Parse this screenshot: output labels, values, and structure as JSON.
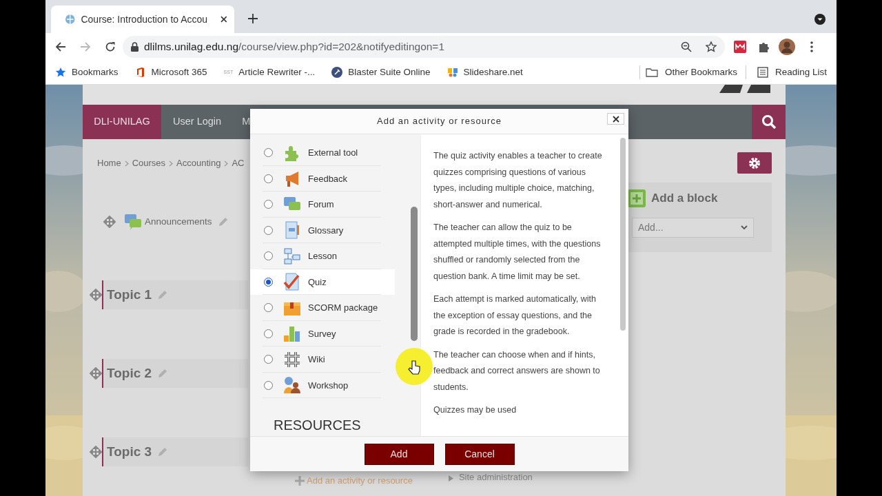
{
  "browser": {
    "tab": {
      "title": "Course: Introduction to Accou"
    },
    "url": {
      "host": "dlilms.unilag.edu.ng",
      "path": "/course/view.php?id=202&notifyeditingon=1"
    },
    "bookmarks": [
      {
        "label": "Bookmarks"
      },
      {
        "label": "Microsoft 365"
      },
      {
        "label": "Article Rewriter -...",
        "icon_text": "SST"
      },
      {
        "label": "Blaster Suite Online"
      },
      {
        "label": "Slideshare.net"
      }
    ],
    "other_bookmarks": "Other Bookmarks",
    "reading_list": "Reading List"
  },
  "site": {
    "navbar": [
      {
        "label": "DLI-UNILAG",
        "selected": true
      },
      {
        "label": "User Login",
        "selected": false
      },
      {
        "label": "M",
        "selected": false
      }
    ],
    "breadcrumb": [
      "Home",
      "Courses",
      "Accounting",
      "AC"
    ],
    "announcements": "Announcements",
    "topics": [
      "Topic 1",
      "Topic 2",
      "Topic 3"
    ],
    "add_activity_link": "Add an activity or resource",
    "site_administration": "Site administration",
    "add_block": {
      "title": "Add a block",
      "select": "Add..."
    }
  },
  "modal": {
    "title": "Add an activity or resource",
    "activities": [
      {
        "label": "External tool",
        "selected": false
      },
      {
        "label": "Feedback",
        "selected": false
      },
      {
        "label": "Forum",
        "selected": false
      },
      {
        "label": "Glossary",
        "selected": false
      },
      {
        "label": "Lesson",
        "selected": false
      },
      {
        "label": "Quiz",
        "selected": true
      },
      {
        "label": "SCORM package",
        "selected": false
      },
      {
        "label": "Survey",
        "selected": false
      },
      {
        "label": "Wiki",
        "selected": false
      },
      {
        "label": "Workshop",
        "selected": false
      }
    ],
    "section_heading": "RESOURCES",
    "description": [
      "The quiz activity enables a teacher to create quizzes comprising questions of various types, including multiple choice, matching, short-answer and numerical.",
      "The teacher can allow the quiz to be attempted multiple times, with the questions shuffled or randomly selected from the question bank. A time limit may be set.",
      "Each attempt is marked automatically, with the exception of essay questions, and the grade is recorded in the gradebook.",
      "The teacher can choose when and if hints, feedback and correct answers are shown to students.",
      "Quizzes may be used"
    ],
    "buttons": [
      {
        "label": "Add"
      },
      {
        "label": "Cancel"
      }
    ]
  }
}
